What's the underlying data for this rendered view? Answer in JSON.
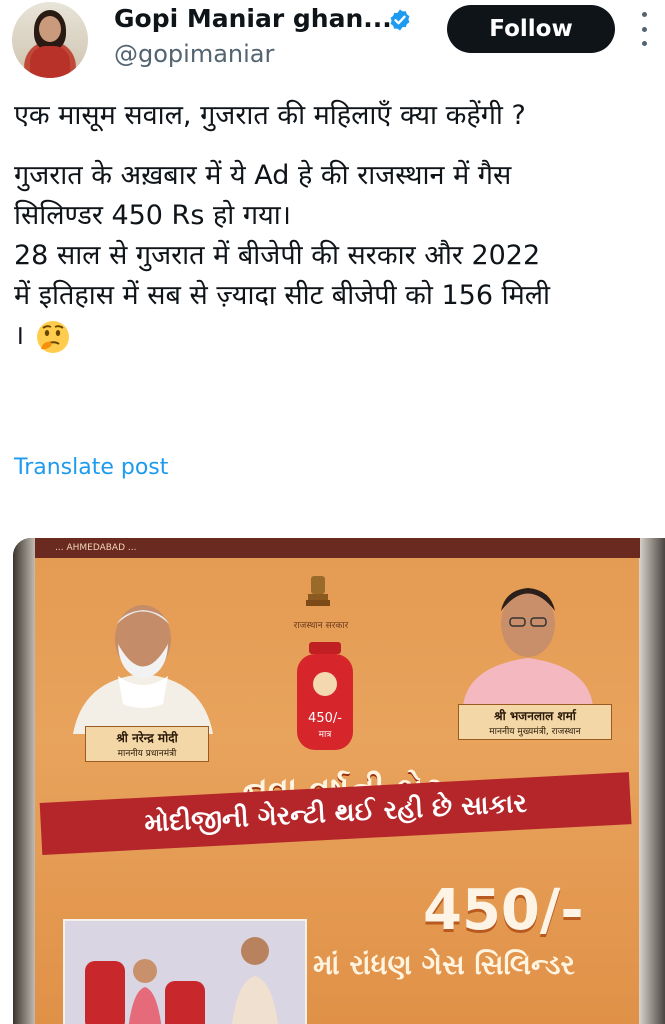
{
  "header": {
    "display_name": "Gopi Maniar ghan...",
    "handle": "@gopimaniar",
    "follow_label": "Follow"
  },
  "tweet": {
    "lines": [
      "एक मासूम सवाल, गुजरात की महिलाएँ क्या कहेंगी ?",
      "गुजरात के अख़बार में ये Ad हे की राजस्थान में गैस",
      "सिलिण्डर 450 Rs हो गया।",
      "28 साल से गुजरात में बीजेपी की सरकार और 2022",
      "में इतिहास में सब से ज़्यादा सीट बीजेपी को 156 मिली",
      "।"
    ],
    "emoji": "🤔",
    "translate_label": "Translate post"
  },
  "media": {
    "masthead": "... AHMEDABAD ...",
    "emblem_caption": "राजस्थान सरकार",
    "cylinder_price": "450/-",
    "cylinder_sub": "मात्र",
    "left_name": "श्री नरेन्द्र मोदी",
    "left_title": "माननीय प्रधानमंत्री",
    "right_name": "श्री भजनलाल शर्मा",
    "right_title": "माननीय मुख्यमंत्री, राजस्थान",
    "headline": "નવા વર્ષની ભેટ",
    "band_text": "મોદીજીની ગેરન્ટી થઈ રહી છે સાકાર",
    "price": "450/-",
    "price_caption": "માં રાંધણ ગેસ સિલિન્ડર"
  },
  "colors": {
    "follow_bg": "#0f1419",
    "link": "#1d9bf0",
    "verified": "#1d9bf0",
    "ad_band": "#b5262b"
  }
}
